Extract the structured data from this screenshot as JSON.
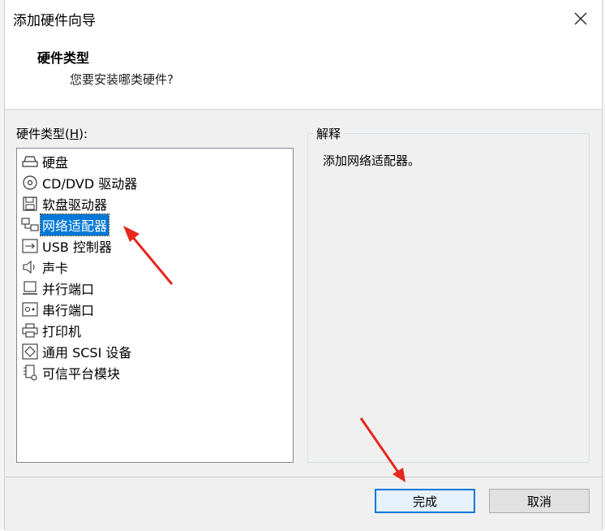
{
  "dialog": {
    "title": "添加硬件向导",
    "close_icon": "close-icon"
  },
  "header": {
    "title": "硬件类型",
    "subtitle": "您要安装哪类硬件?"
  },
  "hardware_list": {
    "label_prefix": "硬件类型(",
    "label_hotkey": "H",
    "label_suffix": "):",
    "items": [
      {
        "label": "硬盘",
        "icon": "hard-disk-icon"
      },
      {
        "label": "CD/DVD 驱动器",
        "icon": "cd-dvd-icon"
      },
      {
        "label": "软盘驱动器",
        "icon": "floppy-icon"
      },
      {
        "label": "网络适配器",
        "icon": "network-adapter-icon",
        "selected": true
      },
      {
        "label": "USB 控制器",
        "icon": "usb-icon"
      },
      {
        "label": "声卡",
        "icon": "sound-card-icon"
      },
      {
        "label": "并行端口",
        "icon": "parallel-port-icon"
      },
      {
        "label": "串行端口",
        "icon": "serial-port-icon"
      },
      {
        "label": "打印机",
        "icon": "printer-icon"
      },
      {
        "label": "通用 SCSI 设备",
        "icon": "scsi-icon"
      },
      {
        "label": "可信平台模块",
        "icon": "tpm-icon"
      }
    ]
  },
  "description": {
    "title": "解释",
    "text": "添加网络适配器。"
  },
  "buttons": {
    "finish": "完成",
    "cancel": "取消"
  },
  "colors": {
    "selection": "#0078d7",
    "annotation_arrow": "#e8281e"
  }
}
